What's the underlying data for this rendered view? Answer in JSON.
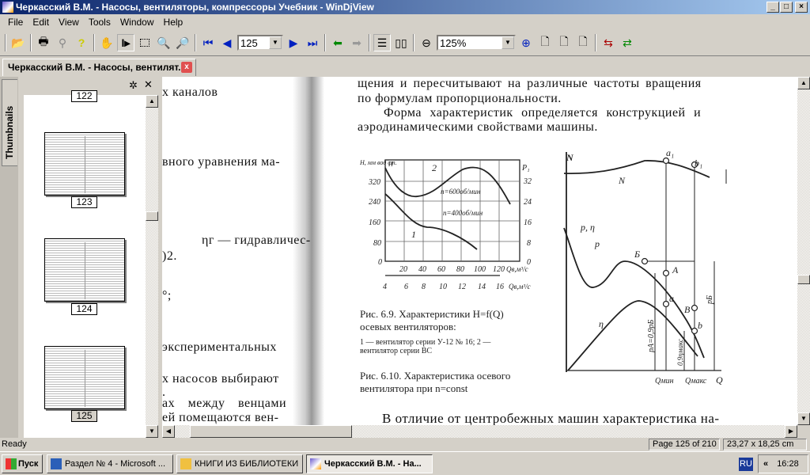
{
  "window": {
    "title": "Черкасский В.М. - Насосы, вентиляторы, компрессоры Учебник - WinDjView",
    "min": "_",
    "max": "□",
    "close": "×"
  },
  "menu": [
    "File",
    "Edit",
    "View",
    "Tools",
    "Window",
    "Help"
  ],
  "toolbar": {
    "page_value": "125",
    "zoom_value": "125%"
  },
  "tab": {
    "label": "Черкасский В.М. - Насосы, вентилят...",
    "close": "x"
  },
  "sidebar": {
    "tab_label": "Thumbnails",
    "thumbnails": [
      {
        "page": "122"
      },
      {
        "page": "123"
      },
      {
        "page": "124"
      },
      {
        "page": "125",
        "selected": true
      }
    ]
  },
  "document": {
    "left_page_lines": [
      "х каналов",
      "вного уравнения ма-",
      "ηг — гидравличес-",
      ")2.",
      "°;",
      "экспериментальных",
      "х насосов выбирают",
      ".",
      "ах между венцами",
      "ей помещаются вен-"
    ],
    "right_page_lines": [
      "щения и пересчитывают на различные частоты вращения",
      "по формулам пропорциональности.",
      "Форма характеристик определяется конструкцией и",
      "аэродинамическими свойствами машины."
    ],
    "bottom_line": "В отличие от центробежных машин характеристика на-",
    "fig69": {
      "y_label": "H, мм вод ст.",
      "y_label2": "H",
      "y_ticks": [
        "320",
        "240",
        "160",
        "80",
        "0"
      ],
      "y2_label": "P₁",
      "y2_ticks": [
        "32",
        "24",
        "16",
        "8",
        "0"
      ],
      "x_ticks": [
        "20",
        "40",
        "60",
        "80",
        "100",
        "120"
      ],
      "x_label": "Qв,м³/с",
      "x2_ticks": [
        "4",
        "6",
        "8",
        "10",
        "12",
        "14",
        "16"
      ],
      "x2_label": "Qв,м³/с",
      "curve2_label": "2",
      "curve2_speed": "n=600об/мин",
      "curve1_label": "1",
      "curve1_speed": "n=400об/мин",
      "caption": "Рис. 6.9. Характеристики H=f(Q)",
      "caption2": "осевых вентиляторов:",
      "legend1": "1 — вентилятор серии У-12 № 16; 2 —",
      "legend2": "вентилятор серии ВС"
    },
    "fig610": {
      "y_label": "N",
      "n_label": "N",
      "pe_label": "p, η",
      "p_label": "p",
      "eta_label": "η",
      "pts": [
        "a₁",
        "b₁",
        "Б",
        "A",
        "a",
        "B",
        "b"
      ],
      "pa_label": "pA=0,9pБ",
      "eta_max_label": "0,9ηмакс",
      "pb_label": "pБ",
      "qmin": "Qмин",
      "qmax": "Qмакс",
      "q": "Q",
      "caption": "Рис. 6.10. Характеристика осевого",
      "caption2": "вентилятора при n=const"
    }
  },
  "status": {
    "text": "Ready",
    "page": "Page 125 of 210",
    "size": "23,27 x 18,25 cm"
  },
  "taskbar": {
    "start": "Пуск",
    "tasks": [
      "Раздел № 4 - Microsoft ...",
      "КНИГИ ИЗ БИБЛИОТЕКИ",
      "Черкасский В.М. - На..."
    ],
    "lang": "RU",
    "clock": "16:28"
  }
}
